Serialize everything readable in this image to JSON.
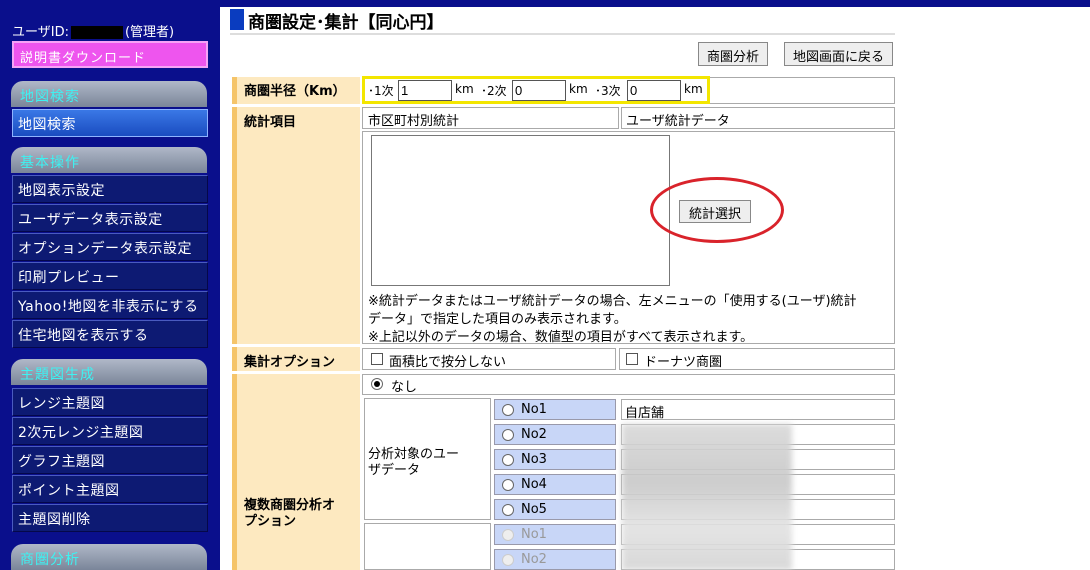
{
  "sidebar": {
    "user_id_label": "ユーザID:",
    "user_role": "(管理者)",
    "manual_download": "説明書ダウンロード",
    "sections": [
      {
        "title": "地図検索",
        "items": [
          "地図検索"
        ]
      },
      {
        "title": "基本操作",
        "items": [
          "地図表示設定",
          "ユーザデータ表示設定",
          "オプションデータ表示設定",
          "印刷プレビュー",
          "Yahoo!地図を非表示にする",
          "住宅地図を表示する"
        ]
      },
      {
        "title": "主題図生成",
        "items": [
          "レンジ主題図",
          "2次元レンジ主題図",
          "グラフ主題図",
          "ポイント主題図",
          "主題図削除"
        ]
      },
      {
        "title": "商圏分析"
      }
    ]
  },
  "header": {
    "title": "商圏設定･集計【同心円】",
    "analysis_button": "商圏分析",
    "back_button": "地図画面に戻る"
  },
  "radius": {
    "label": "商圏半径（Km）",
    "r1_label": "･1次",
    "r1_value": "1",
    "r2_label": "･2次",
    "r2_value": "0",
    "r3_label": "･3次",
    "r3_value": "0",
    "unit": "km"
  },
  "stats": {
    "label": "統計項目",
    "tab_municipal": "市区町村別統計",
    "tab_user": "ユーザ統計データ",
    "select_button": "統計選択",
    "note1": "※統計データまたはユーザ統計データの場合、左メニューの「使用する(ユーザ)統計",
    "note2": "データ」で指定した項目のみ表示されます。",
    "note3": "※上記以外のデータの場合、数値型の項目がすべて表示されます。"
  },
  "aggregate": {
    "label": "集計オプション",
    "area_ratio": "面積比で按分しない",
    "donut": "ドーナツ商圏"
  },
  "multi": {
    "label_line1": "複数商圏分析オ",
    "label_line2": "プション",
    "none_option": "なし",
    "target_label_line1": "分析対象のユー",
    "target_label_line2": "ザデータ",
    "rows": [
      "No1",
      "No2",
      "No3",
      "No4",
      "No5"
    ],
    "first_value": "自店舗",
    "rows2": [
      "No1",
      "No2"
    ]
  }
}
